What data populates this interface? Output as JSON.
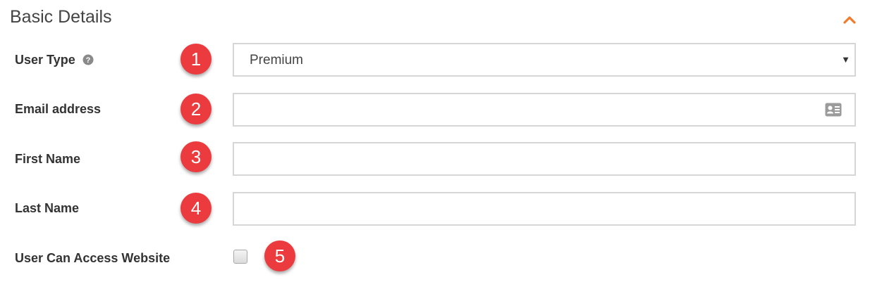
{
  "section": {
    "title": "Basic Details"
  },
  "colors": {
    "accent": "#f07b2a",
    "badge": "#ec3b3f",
    "label": "#333333",
    "border": "#d6d6d6"
  },
  "fields": {
    "user_type": {
      "label": "User Type",
      "value": "Premium",
      "badge": "1"
    },
    "email": {
      "label": "Email address",
      "value": "",
      "badge": "2"
    },
    "first_name": {
      "label": "First Name",
      "value": "",
      "badge": "3"
    },
    "last_name": {
      "label": "Last Name",
      "value": "",
      "badge": "4"
    },
    "website_access": {
      "label": "User Can Access Website",
      "checked": false,
      "badge": "5"
    }
  },
  "icons": {
    "collapse": "chevron-up-icon",
    "help": "question-circle-icon",
    "contact": "contact-card-icon",
    "caret": "caret-down-icon"
  }
}
